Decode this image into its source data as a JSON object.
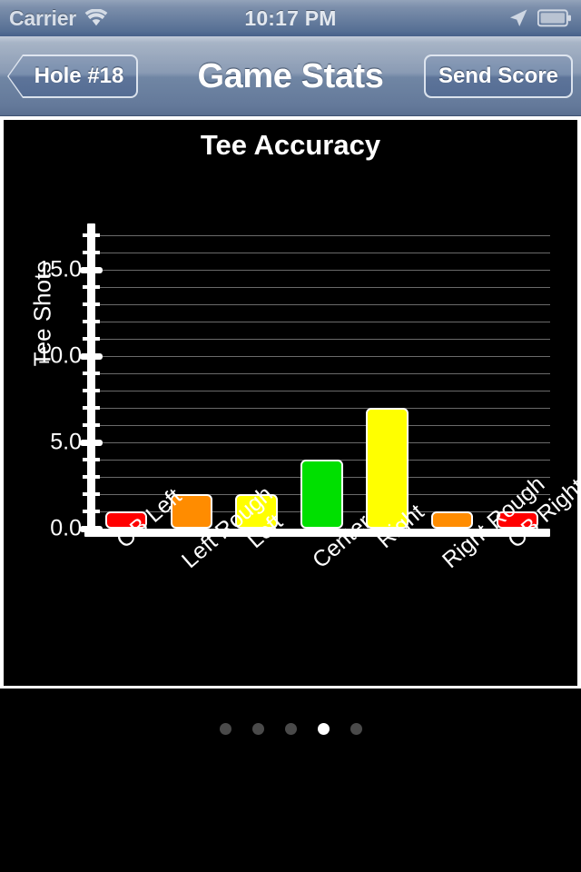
{
  "status_bar": {
    "carrier": "Carrier",
    "time": "10:17 PM",
    "wifi_icon": "wifi-icon",
    "location_icon": "location-arrow-icon",
    "battery_icon": "battery-icon"
  },
  "nav_bar": {
    "back_label": "Hole #18",
    "title": "Game Stats",
    "action_label": "Send Score"
  },
  "chart_data": {
    "type": "bar",
    "title": "Tee Accuracy",
    "xlabel": "",
    "ylabel": "Tee Shots",
    "categories": [
      "OB Left",
      "Left Rough",
      "Left",
      "Center",
      "Right",
      "Right Rough",
      "OB Right"
    ],
    "values": [
      1,
      2,
      2,
      4,
      7,
      1,
      1
    ],
    "colors": [
      "#ff0000",
      "#ff8c00",
      "#ffff00",
      "#00e000",
      "#ffff00",
      "#ff8c00",
      "#ff0000"
    ],
    "ylim": [
      0,
      17.5
    ],
    "ytick_labels": [
      "0.0",
      "5.0",
      "10.0",
      "15.0"
    ],
    "ytick_values": [
      0,
      5,
      10,
      15
    ],
    "minor_tick_step": 1,
    "grid": true,
    "background": "#000000",
    "foreground": "#ffffff",
    "legend": null
  },
  "page_control": {
    "total": 5,
    "active_index": 3
  }
}
